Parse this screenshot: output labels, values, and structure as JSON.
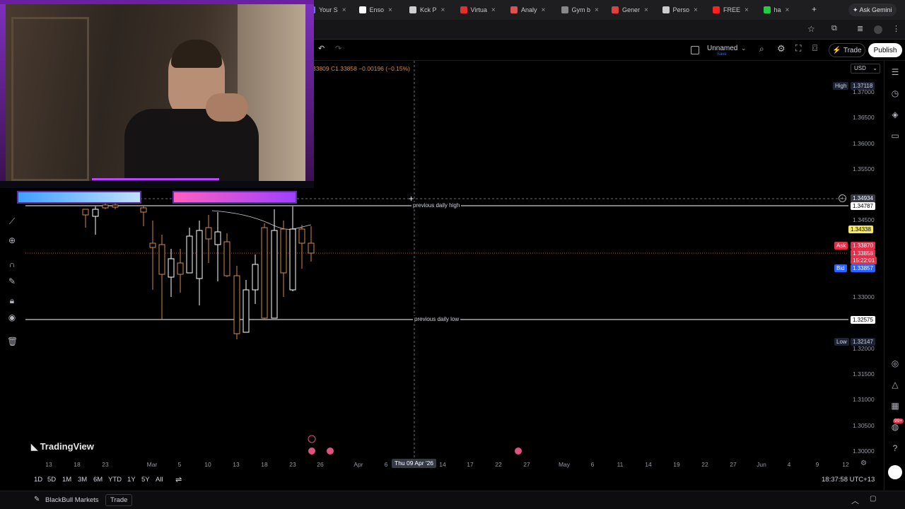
{
  "browser": {
    "tabs": [
      {
        "label": "Your S",
        "color": "#6c6cff"
      },
      {
        "label": "Enso",
        "color": "#ffffff"
      },
      {
        "label": "Kck P",
        "color": "#cfcfcf"
      },
      {
        "label": "Virtua",
        "color": "#e03030"
      },
      {
        "label": "Analy",
        "color": "#e05050"
      },
      {
        "label": "Gym b",
        "color": "#888888"
      },
      {
        "label": "Gener",
        "color": "#e04040"
      },
      {
        "label": "Perso",
        "color": "#cccccc"
      },
      {
        "label": "FREE",
        "color": "#ff2020"
      },
      {
        "label": "ha",
        "color": "#22cc44"
      }
    ],
    "new_tab": "+",
    "ask_gemini": "Ask Gemini"
  },
  "toolbar": {
    "layout_name": "Unnamed",
    "layout_sub": "Save",
    "trade": "Trade",
    "publish": "Publish"
  },
  "legend": {
    "ohlc_text": "33809  C1.33858  −0.00196 (−0.15%)"
  },
  "currency": "USD",
  "price_axis": {
    "labels": [
      "1.37000",
      "1.36500",
      "1.36000",
      "1.35500",
      "1.34500",
      "1.33000",
      "1.32000",
      "1.31500",
      "1.31000",
      "1.30500",
      "1.30000"
    ],
    "high_label": "High",
    "high_value": "1.37118",
    "crosshair_value": "1.34934",
    "prev_high_value": "1.34787",
    "yellow_value": "1.34338",
    "ask_label": "Ask",
    "ask_value": "1.33870",
    "last_value": "1.33858",
    "countdown": "15:22:01",
    "bid_label": "Bid",
    "bid_value": "1.33857",
    "prev_low_value": "1.32575",
    "low_label": "Low",
    "low_value": "1.32147"
  },
  "annotations": {
    "prev_high": "previous daily high",
    "prev_low": "previous daily low"
  },
  "time_axis": {
    "labels": [
      "13",
      "18",
      "23",
      "Mar",
      "5",
      "10",
      "13",
      "18",
      "23",
      "26",
      "Apr",
      "6",
      "14",
      "17",
      "22",
      "27",
      "May",
      "6",
      "11",
      "14",
      "19",
      "22",
      "27",
      "Jun",
      "4",
      "9",
      "12"
    ],
    "crosshair_date": "Thu 09 Apr '26"
  },
  "ranges": [
    "1D",
    "5D",
    "1M",
    "3M",
    "6M",
    "YTD",
    "1Y",
    "5Y",
    "All"
  ],
  "clock": "18:37:58 UTC+13",
  "watermark": "TradingView",
  "status": {
    "broker": "BlackBull Markets",
    "trade": "Trade"
  },
  "notification_badge": "99+",
  "colors": {
    "up": "#ffffff",
    "down": "#d18a4c",
    "ask": "#e0304a",
    "bid": "#2962ff",
    "yellow": "#f5e663",
    "webcam_accent": "#c040ff"
  }
}
